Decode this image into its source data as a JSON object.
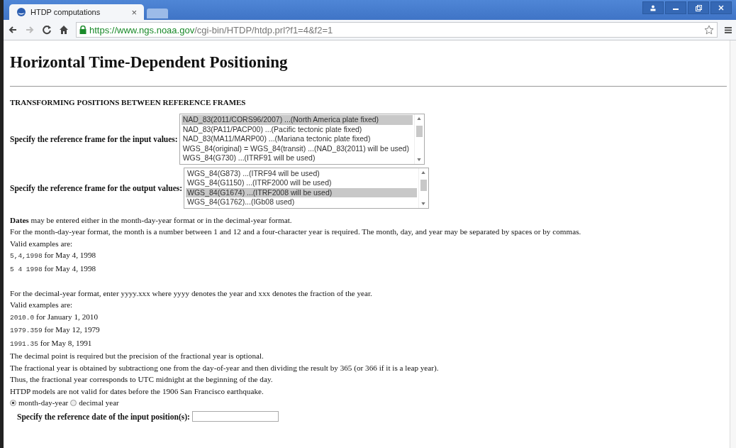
{
  "browser": {
    "tab": {
      "title": "HTDP computations",
      "close": "×"
    },
    "url": {
      "host": "https://www.ngs.noaa.gov",
      "path": "/cgi-bin/HTDP/htdp.prl?f1=4&f2=1"
    }
  },
  "page": {
    "title": "Horizontal Time-Dependent Positioning",
    "section": "TRANSFORMING POSITIONS BETWEEN REFERENCE FRAMES",
    "input_frame": {
      "label": "Specify the reference frame for the input values:",
      "options": [
        {
          "text": "NAD_83(2011/CORS96/2007) ...(North America plate fixed)",
          "selected": true
        },
        {
          "text": "NAD_83(PA11/PACP00) ...(Pacific tectonic plate fixed)",
          "selected": false
        },
        {
          "text": "NAD_83(MA11/MARP00) ...(Mariana tectonic plate fixed)",
          "selected": false
        },
        {
          "text": "WGS_84(original) = WGS_84(transit) ...(NAD_83(2011) will be used)",
          "selected": false
        },
        {
          "text": "WGS_84(G730) ...(ITRF91 will be used)",
          "selected": false
        }
      ]
    },
    "output_frame": {
      "label": "Specify the reference frame for the output values:",
      "options": [
        {
          "text": "WGS_84(G873) ...(ITRF94 will be used)",
          "selected": false
        },
        {
          "text": "WGS_84(G1150) ...(ITRF2000 will be used)",
          "selected": false
        },
        {
          "text": "WGS_84(G1674) ...(ITRF2008 will be used)",
          "selected": true
        },
        {
          "text": "WGS_84(G1762)...(IGb08 used)",
          "selected": false
        }
      ]
    },
    "lines": [
      {
        "kind": "text",
        "text": "**Dates** may be entered either in the month-day-year format or in the decimal-year format."
      },
      {
        "kind": "text",
        "text": "For the month-day-year format, the month is a number between 1 and 12 and a four-character year is required. The month, day, and year may be separated by spaces or by commas."
      },
      {
        "kind": "text",
        "text": "Valid examples are:"
      },
      {
        "kind": "example",
        "code": "5,4,1998",
        "text": "for May 4, 1998"
      },
      {
        "kind": "example",
        "code": "5 4 1998",
        "text": "for May 4, 1998"
      },
      {
        "kind": "gap"
      },
      {
        "kind": "text",
        "text": "For the decimal-year format, enter yyyy.xxx where yyyy denotes the year and xxx denotes the fraction of the year."
      },
      {
        "kind": "text",
        "text": "Valid examples are:"
      },
      {
        "kind": "example",
        "code": "2010.0",
        "text": "for January 1, 2010"
      },
      {
        "kind": "example",
        "code": "1979.359",
        "text": "for May 12, 1979"
      },
      {
        "kind": "example",
        "code": "1991.35",
        "text": "for May 8, 1991"
      },
      {
        "kind": "text",
        "text": "The decimal point is required but the precision of the fractional year is optional."
      },
      {
        "kind": "text",
        "text": "The fractional year is obtained by subtractiong one from the day-of-year and then dividing the result by 365 (or 366 if it is a leap year)."
      },
      {
        "kind": "text",
        "text": "Thus, the fractional year corresponds to UTC midnight at the beginning of the day."
      },
      {
        "kind": "text",
        "text": "HTDP models are not valid for dates before the 1906 San Francisco earthquake."
      }
    ],
    "date_format": [
      {
        "label": "month-day-year",
        "selected": true
      },
      {
        "label": "decimal year",
        "selected": false
      }
    ],
    "reference_date": {
      "label": "Specify the reference date of the input position(s):"
    }
  }
}
